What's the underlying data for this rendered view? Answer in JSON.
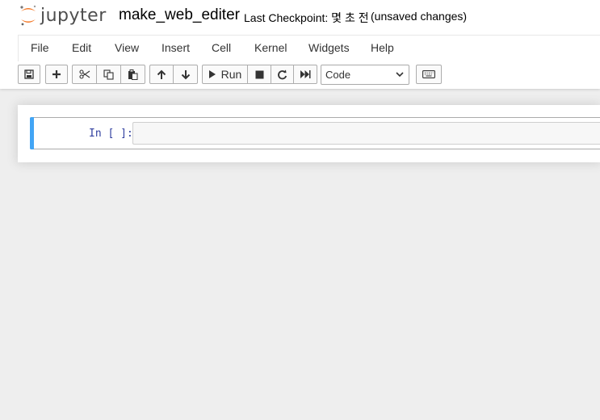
{
  "header": {
    "logo_text": "jupyter",
    "notebook_name": "make_web_editer",
    "checkpoint": "Last Checkpoint: 몇 초 전",
    "autosave_status": "(unsaved changes)"
  },
  "menu": {
    "items": [
      "File",
      "Edit",
      "View",
      "Insert",
      "Cell",
      "Kernel",
      "Widgets",
      "Help"
    ]
  },
  "toolbar": {
    "buttons": [
      {
        "name": "save",
        "icon": "floppy-disk-icon"
      },
      {
        "name": "insert-cell",
        "icon": "plus-icon"
      },
      {
        "name": "cut",
        "icon": "scissors-icon"
      },
      {
        "name": "copy",
        "icon": "copy-icon"
      },
      {
        "name": "paste",
        "icon": "paste-icon"
      },
      {
        "name": "move-up",
        "icon": "arrow-up-icon"
      },
      {
        "name": "move-down",
        "icon": "arrow-down-icon"
      },
      {
        "name": "run",
        "icon": "play-icon",
        "label": "Run"
      },
      {
        "name": "interrupt",
        "icon": "stop-icon"
      },
      {
        "name": "restart",
        "icon": "refresh-icon"
      },
      {
        "name": "restart-run-all",
        "icon": "fast-forward-icon"
      },
      {
        "name": "command-palette",
        "icon": "keyboard-icon"
      }
    ],
    "run_label": "Run",
    "cell_type": "Code"
  },
  "cell": {
    "prompt": "In [ ]:",
    "content": ""
  },
  "colors": {
    "logo_orange": "#f37726",
    "cell_selected_bar": "#42a5f5",
    "prompt_blue": "#303f9f",
    "page_background": "#eeeeee"
  }
}
